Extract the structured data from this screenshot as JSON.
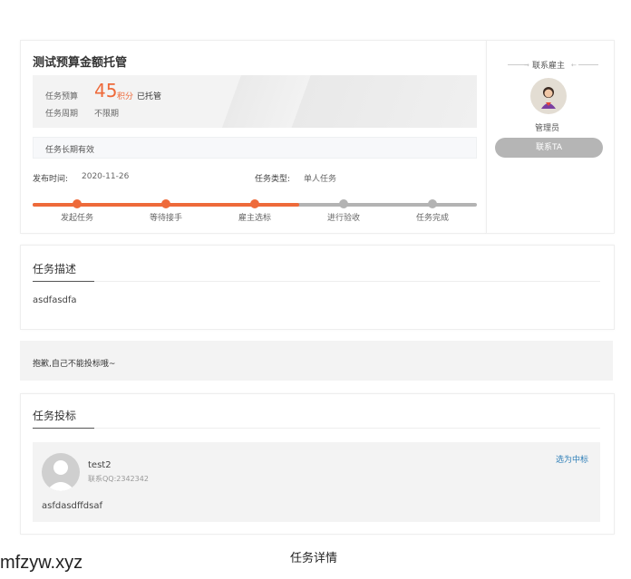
{
  "task": {
    "title": "测试预算金额托管",
    "budget_label": "任务预算",
    "budget_amount": "45",
    "budget_unit": "积分",
    "budget_status": "已托管",
    "period_label": "任务周期",
    "period_value": "不限期",
    "notice": "任务长期有效",
    "publish_label": "发布时间:",
    "publish_date": "2020-11-26",
    "type_label": "任务类型:",
    "type_value": "单人任务"
  },
  "progress": {
    "fraction": 0.6,
    "steps": [
      {
        "label": "发起任务",
        "done": true
      },
      {
        "label": "等待接手",
        "done": true
      },
      {
        "label": "雇主选标",
        "done": true
      },
      {
        "label": "进行验收",
        "done": false
      },
      {
        "label": "任务完成",
        "done": false
      }
    ]
  },
  "employer": {
    "header": "联系雇主",
    "name": "管理员",
    "contact_button": "联系TA"
  },
  "description": {
    "title": "任务描述",
    "content": "asdfasdfa"
  },
  "bid_notice": "抱歉,自己不能投标哦~",
  "bids": {
    "title": "任务投标",
    "items": [
      {
        "username": "test2",
        "qq": "联系QQ:2342342",
        "select_label": "选为中标",
        "content": "asfdasdffdsaf"
      }
    ]
  },
  "caption": "任务详情",
  "watermark": "mfzyw.xyz",
  "colors": {
    "accent": "#ee6a3a",
    "progress_todo": "#b3b3b3",
    "button_gray": "#b5b5b5",
    "link_blue": "#2f7fb8"
  }
}
